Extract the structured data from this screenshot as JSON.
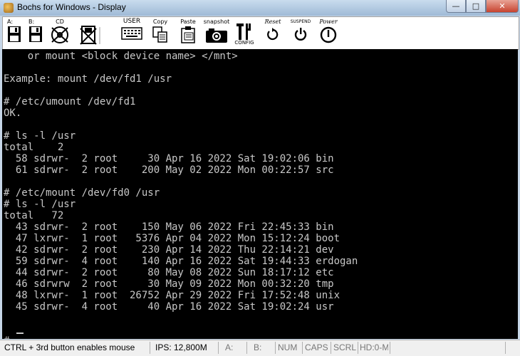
{
  "window": {
    "title": "Bochs for Windows - Display"
  },
  "toolbar": {
    "floppy_a": "A:",
    "floppy_b": "B:",
    "cdrom": "CD",
    "user": "USER",
    "copy": "Copy",
    "paste": "Paste",
    "snapshot": "snapshot",
    "config": "CONFIG",
    "reset": "Reset",
    "suspend": "SUSPEND",
    "power": "Power"
  },
  "console": {
    "lines": [
      "    or mount <block device name> </mnt>",
      "",
      "Example: mount /dev/fd1 /usr",
      "",
      "# /etc/umount /dev/fd1",
      "OK.",
      "",
      "# ls -l /usr",
      "total    2",
      "  58 sdrwr-  2 root     30 Apr 16 2022 Sat 19:02:06 bin",
      "  61 sdrwr-  2 root    200 May 02 2022 Mon 00:22:57 src",
      "",
      "# /etc/mount /dev/fd0 /usr",
      "# ls -l /usr",
      "total   72",
      "  43 sdrwr-  2 root    150 May 06 2022 Fri 22:45:33 bin",
      "  47 lxrwr-  1 root   5376 Apr 04 2022 Mon 15:12:24 boot",
      "  42 sdrwr-  2 root    230 Apr 14 2022 Thu 22:14:21 dev",
      "  59 sdrwr-  4 root    140 Apr 16 2022 Sat 19:44:33 erdogan",
      "  44 sdrwr-  2 root     80 May 08 2022 Sun 18:17:12 etc",
      "  46 sdrwrw  2 root     30 May 09 2022 Mon 00:32:20 tmp",
      "  48 lxrwr-  1 root  26752 Apr 29 2022 Fri 17:52:48 unix",
      "  45 sdrwr-  4 root     40 Apr 16 2022 Sat 19:02:24 usr",
      "",
      "",
      "# "
    ]
  },
  "status": {
    "mouse_hint": "CTRL + 3rd button enables mouse",
    "ips": "IPS: 12,800M",
    "a": "A:",
    "b": "B:",
    "num": "NUM",
    "caps": "CAPS",
    "scrl": "SCRL",
    "hd": "HD:0-M"
  }
}
